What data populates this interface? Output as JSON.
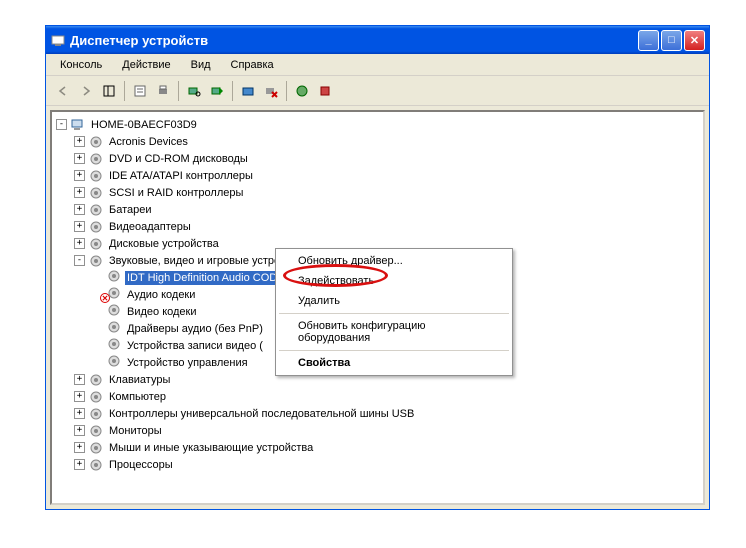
{
  "title": "Диспетчер устройств",
  "menu": {
    "console": "Консоль",
    "action": "Действие",
    "view": "Вид",
    "help": "Справка"
  },
  "root": "HOME-0BAECF03D9",
  "categories": [
    "Acronis Devices",
    "DVD и CD-ROM дисководы",
    "IDE ATA/ATAPI контроллеры",
    "SCSI и RAID контроллеры",
    "Батареи",
    "Видеоадаптеры",
    "Дисковые устройства",
    "Звуковые, видео и игровые устройства",
    "Клавиатуры",
    "Компьютер",
    "Контроллеры универсальной последовательной шины USB",
    "Мониторы",
    "Мыши и иные указывающие устройства",
    "Процессоры"
  ],
  "sound_devices": [
    "IDT High Definition Audio CODEC",
    "Аудио кодеки",
    "Видео кодеки",
    "Драйверы аудио (без PnP)",
    "Устройства записи видео (",
    "Устройство управления"
  ],
  "context": {
    "update": "Обновить драйвер...",
    "enable": "Задействовать",
    "uninstall": "Удалить",
    "scan": "Обновить конфигурацию оборудования",
    "properties": "Свойства"
  }
}
